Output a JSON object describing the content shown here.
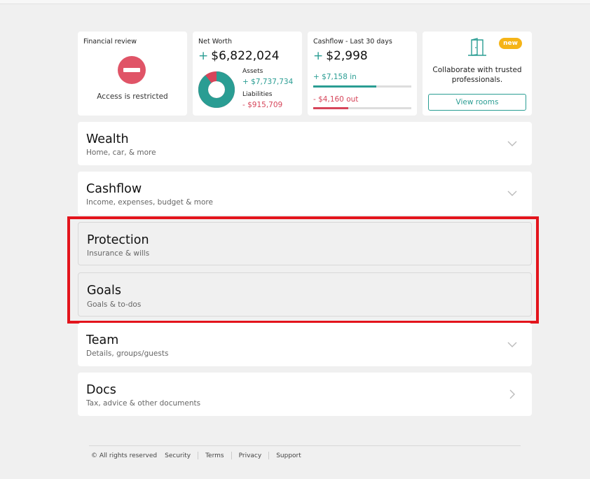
{
  "cards": {
    "financial_review": {
      "title": "Financial review",
      "status_text": "Access is restricted",
      "icon": "no-entry-icon"
    },
    "net_worth": {
      "title": "Net Worth",
      "sign": "+",
      "value": "$6,822,024",
      "assets_label": "Assets",
      "assets_value": "+ $7,737,734",
      "liabilities_label": "Liabilities",
      "liabilities_value": "- $915,709",
      "assets_share": 0.894
    },
    "cashflow": {
      "title": "Cashflow - Last 30 days",
      "sign": "+",
      "value": "$2,998",
      "in_text": "+ $7,158 in",
      "out_text": "- $4,160 out",
      "in_fill_fraction": 0.64,
      "out_fill_fraction": 0.36
    },
    "collaborate": {
      "badge": "new",
      "text": "Collaborate with trusted professionals.",
      "button_label": "View rooms",
      "icon": "door-icon"
    }
  },
  "sections": [
    {
      "title": "Wealth",
      "subtitle": "Home, car, & more",
      "icon": "chevron-down-icon"
    },
    {
      "title": "Cashflow",
      "subtitle": "Income, expenses, budget & more",
      "icon": "chevron-down-icon"
    },
    {
      "title": "Protection",
      "subtitle": "Insurance & wills"
    },
    {
      "title": "Goals",
      "subtitle": "Goals & to-dos"
    },
    {
      "title": "Team",
      "subtitle": "Details, groups/guests",
      "icon": "chevron-down-icon"
    },
    {
      "title": "Docs",
      "subtitle": "Tax, advice & other documents",
      "icon": "chevron-right-icon"
    }
  ],
  "footer": {
    "copyright": "© All rights reserved",
    "links": [
      "Security",
      "Terms",
      "Privacy",
      "Support"
    ]
  },
  "colors": {
    "accent": "#2a9d93",
    "negative": "#d6455a",
    "badge": "#f5b417",
    "highlight": "#e3141c"
  }
}
